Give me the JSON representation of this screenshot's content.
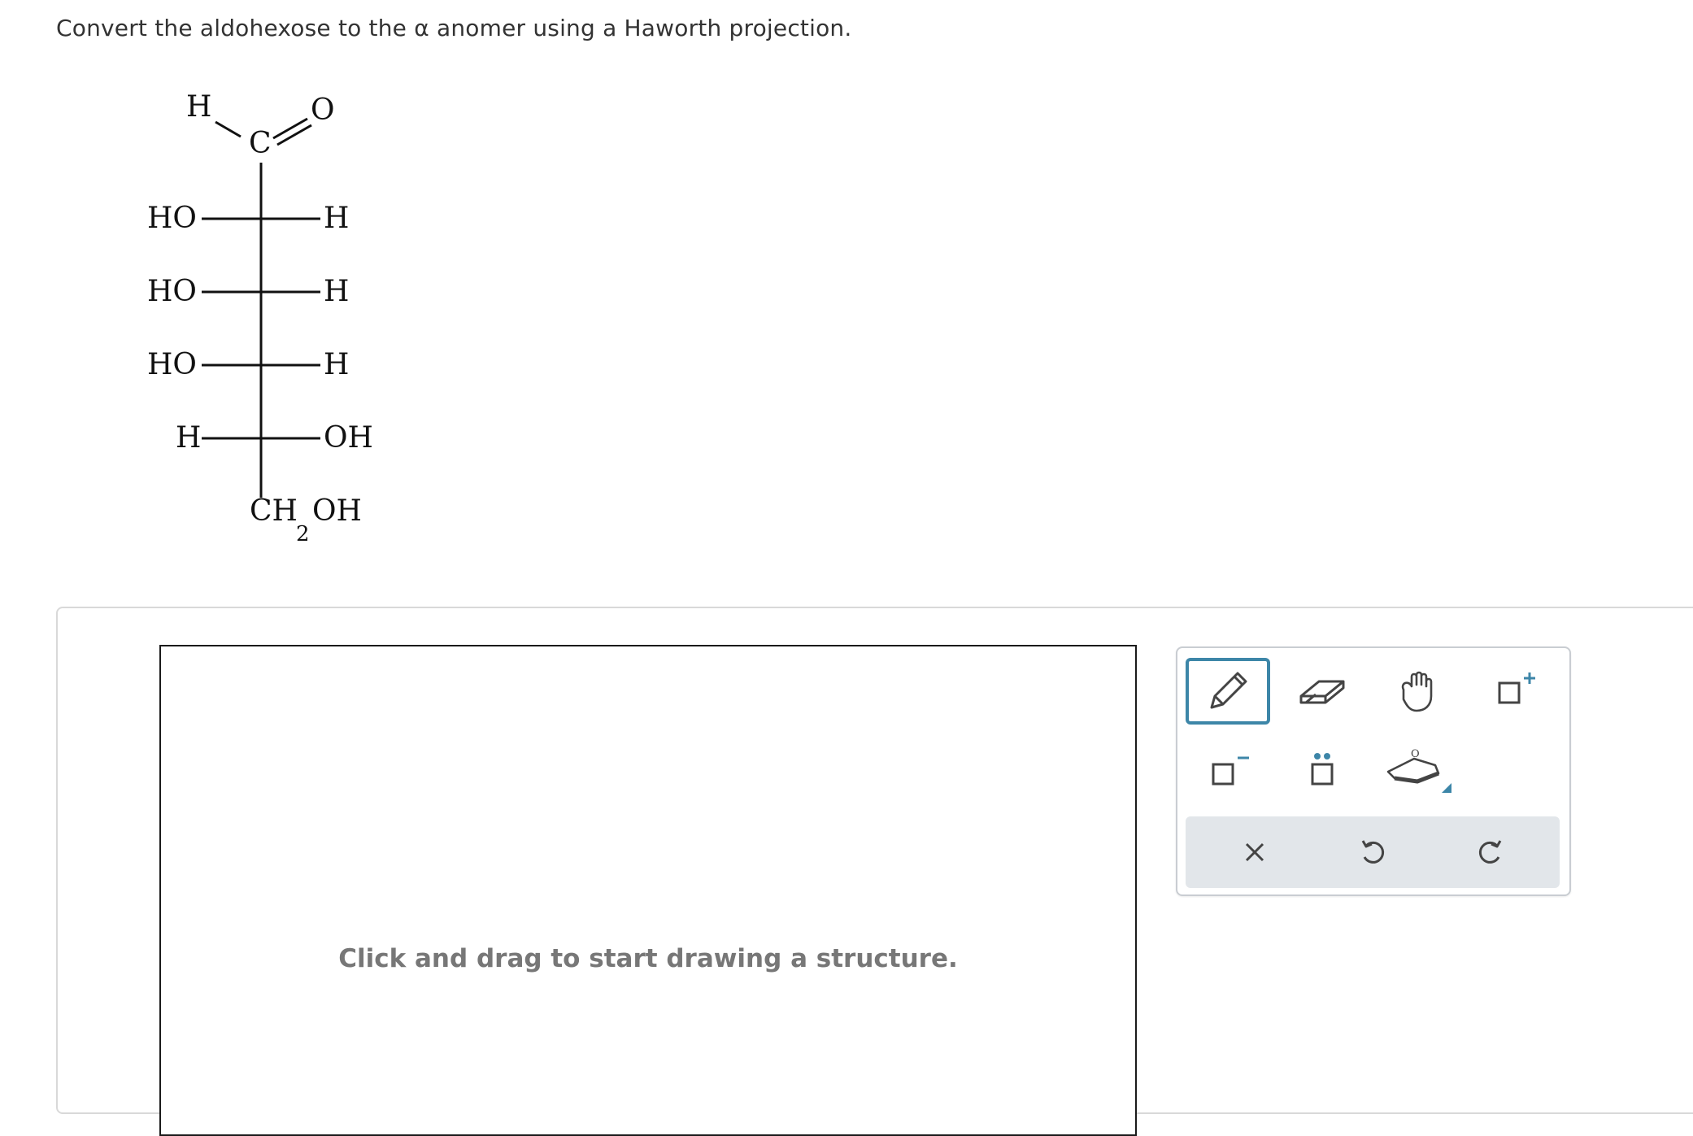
{
  "question": {
    "prefix": "Convert the aldohexose to the ",
    "alpha": "α",
    "suffix": " anomer using a Haworth projection."
  },
  "fischer": {
    "aldehyde_h": "H",
    "aldehyde_c": "C",
    "aldehyde_o": "O",
    "rows": [
      {
        "left": "HO",
        "right": "H"
      },
      {
        "left": "HO",
        "right": "H"
      },
      {
        "left": "HO",
        "right": "H"
      },
      {
        "left": "H",
        "right": "OH"
      }
    ],
    "bottom_main": "CH",
    "bottom_sub": "2",
    "bottom_tail": "OH"
  },
  "canvas": {
    "hint": "Click and drag to start drawing a structure."
  },
  "toolbar": {
    "selected_tool": "pencil",
    "ring_label": "O",
    "tools": [
      "pencil-icon",
      "eraser-icon",
      "hand-icon",
      "charge-plus-icon",
      "charge-minus-icon",
      "lone-pair-icon",
      "haworth-ring-icon"
    ],
    "actions": [
      "clear-icon",
      "undo-icon",
      "redo-icon"
    ]
  },
  "colors": {
    "accent": "#3d86a8",
    "hint": "#777777",
    "action_bar": "#e2e6ea"
  }
}
